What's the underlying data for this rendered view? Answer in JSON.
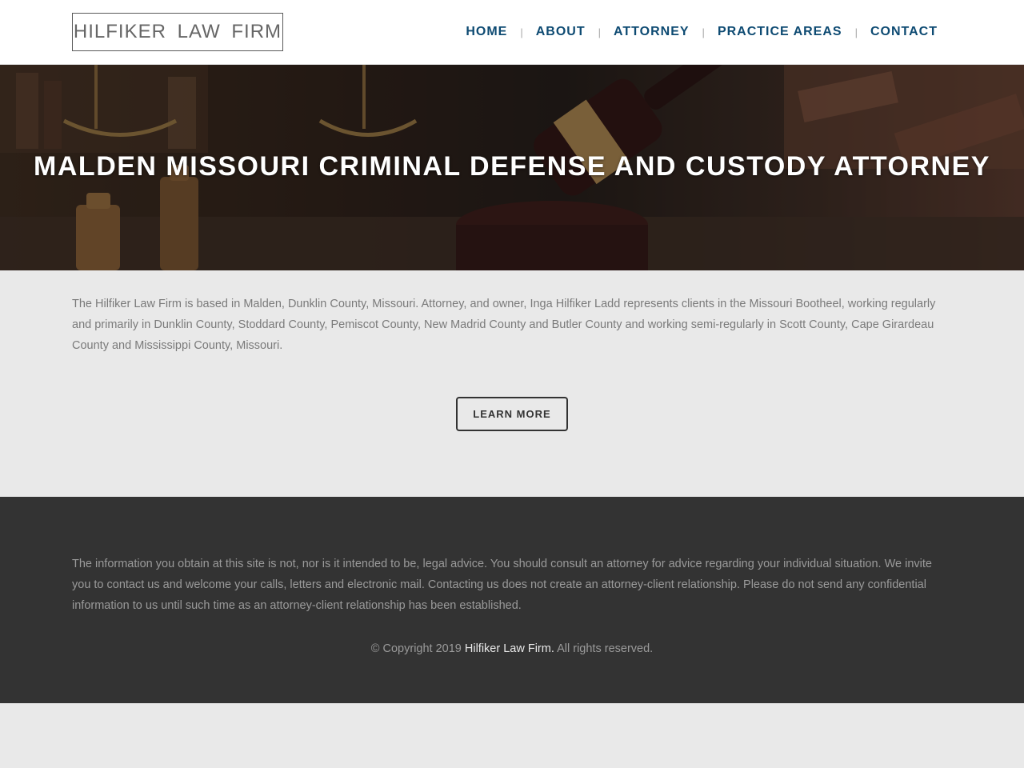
{
  "header": {
    "logo_text": "HILFIKER LAW FIRM",
    "nav": [
      {
        "label": "HOME"
      },
      {
        "label": "ABOUT"
      },
      {
        "label": "ATTORNEY"
      },
      {
        "label": "PRACTICE AREAS"
      },
      {
        "label": "CONTACT"
      }
    ],
    "nav_separator": "|"
  },
  "hero": {
    "title": "MALDEN MISSOURI CRIMINAL DEFENSE AND CUSTODY ATTORNEY",
    "background_image": "gavel-and-scales-photo"
  },
  "intro": {
    "text": "The Hilfiker Law Firm is based in Malden, Dunklin County, Missouri. Attorney, and owner, Inga Hilfiker Ladd represents clients in the Missouri Bootheel, working regularly and primarily in Dunklin County, Stoddard County, Pemiscot County, New Madrid County and Butler County and working semi-regularly in Scott County, Cape Girardeau County and Mississippi County, Missouri.",
    "button_label": "LEARN MORE"
  },
  "footer": {
    "disclaimer": "The information you obtain at this site is not, nor is it intended to be, legal advice. You should consult an attorney for advice regarding your individual situation. We invite you to contact us and welcome your calls, letters and electronic mail. Contacting us does not create an attorney-client relationship. Please do not send any confidential information to us until such time as an attorney-client relationship has been established.",
    "copyright_prefix": "© Copyright 2019",
    "copyright_link": "Hilfiker Law Firm.",
    "copyright_suffix": "All rights reserved."
  },
  "colors": {
    "nav_link": "#0d4a72",
    "footer_bg": "#333333",
    "page_bg": "#e9e9e9"
  }
}
